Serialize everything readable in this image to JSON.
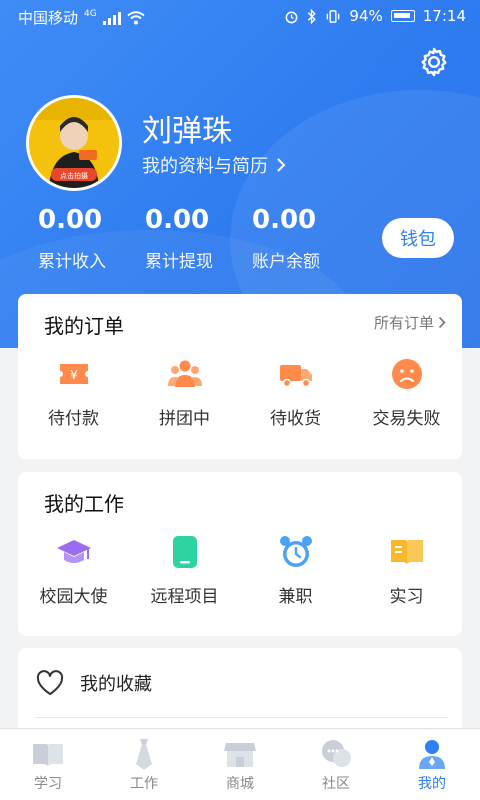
{
  "status_bar": {
    "carrier": "中国移动",
    "network": "4G",
    "battery": "94%",
    "time": "17:14"
  },
  "profile": {
    "name": "刘弹珠",
    "link_label": "我的资料与简历",
    "avatar_text": "点击拍摄"
  },
  "stats": [
    {
      "value": "0.00",
      "label": "累计收入"
    },
    {
      "value": "0.00",
      "label": "累计提现"
    },
    {
      "value": "0.00",
      "label": "账户余额"
    }
  ],
  "wallet_label": "钱包",
  "orders": {
    "title": "我的订单",
    "more_label": "所有订单",
    "items": [
      {
        "label": "待付款",
        "icon": "payment-ticket-icon"
      },
      {
        "label": "拼团中",
        "icon": "group-people-icon"
      },
      {
        "label": "待收货",
        "icon": "delivery-truck-icon"
      },
      {
        "label": "交易失败",
        "icon": "sad-face-icon"
      }
    ]
  },
  "work": {
    "title": "我的工作",
    "items": [
      {
        "label": "校园大使",
        "icon": "graduation-cap-icon"
      },
      {
        "label": "远程项目",
        "icon": "phone-icon"
      },
      {
        "label": "兼职",
        "icon": "alarm-clock-icon"
      },
      {
        "label": "实习",
        "icon": "book-icon"
      }
    ]
  },
  "favorites_label": "我的收藏",
  "bottom_nav": [
    {
      "label": "学习",
      "icon": "book-open-icon",
      "active": false
    },
    {
      "label": "工作",
      "icon": "tie-icon",
      "active": false
    },
    {
      "label": "商城",
      "icon": "store-icon",
      "active": false
    },
    {
      "label": "社区",
      "icon": "chat-bubbles-icon",
      "active": false
    },
    {
      "label": "我的",
      "icon": "user-icon",
      "active": true
    }
  ],
  "colors": {
    "primary": "#2f80ef",
    "orange": "#ff8a4c",
    "purple": "#9b6cf0",
    "green": "#2ed3a2",
    "sky": "#4aa3f5",
    "yellow": "#f7b72f"
  }
}
